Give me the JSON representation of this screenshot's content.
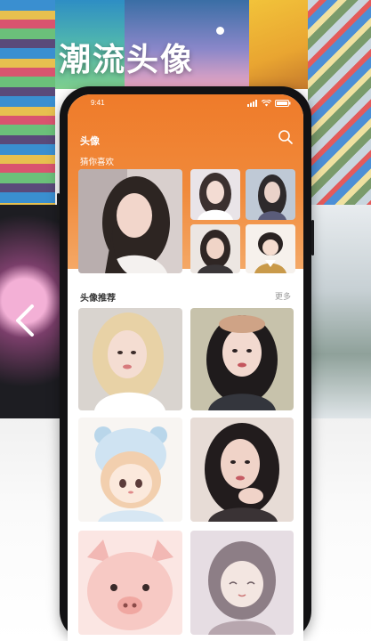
{
  "promo": {
    "title": "潮流头像"
  },
  "status_bar": {
    "time": "9:41"
  },
  "app": {
    "title": "头像",
    "section_guess": "猜你喜欢",
    "section_recommended": "头像推荐",
    "more_label": "更多"
  },
  "icons": {
    "back": "chevron-left-icon",
    "search": "search-icon",
    "signal": "signal-icon",
    "wifi": "wifi-icon",
    "battery": "battery-icon"
  },
  "colors": {
    "accent": "#ef7b2a"
  }
}
